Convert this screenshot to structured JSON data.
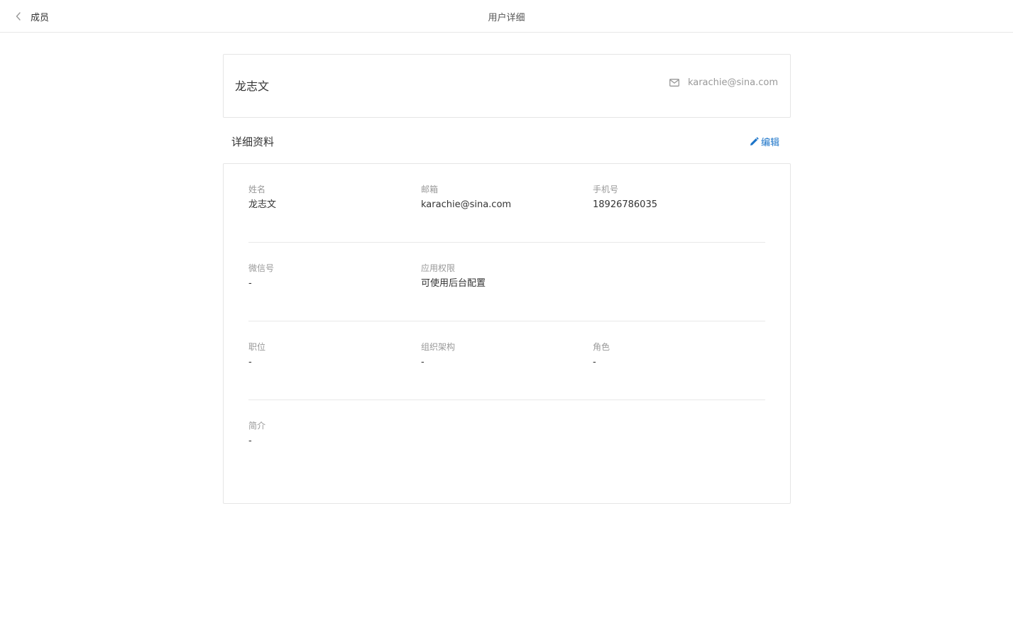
{
  "topbar": {
    "back_label": "成员",
    "title": "用户详细"
  },
  "summary": {
    "name": "龙志文",
    "email": "karachie@sina.com"
  },
  "section": {
    "title": "详细资料",
    "edit_label": "编辑"
  },
  "details": {
    "name_label": "姓名",
    "name_value": "龙志文",
    "email_label": "邮箱",
    "email_value": "karachie@sina.com",
    "phone_label": "手机号",
    "phone_value": "18926786035",
    "wechat_label": "微信号",
    "wechat_value": "-",
    "permission_label": "应用权限",
    "permission_value": "可使用后台配置",
    "position_label": "职位",
    "position_value": "-",
    "org_label": "组织架构",
    "org_value": "-",
    "role_label": "角色",
    "role_value": "-",
    "bio_label": "简介",
    "bio_value": "-"
  },
  "colors": {
    "accent": "#1a73c8",
    "muted_text": "#999999",
    "border": "#e5e5e5"
  },
  "icons": {
    "back": "chevron-left-icon",
    "email": "envelope-icon",
    "edit": "pencil-icon"
  }
}
